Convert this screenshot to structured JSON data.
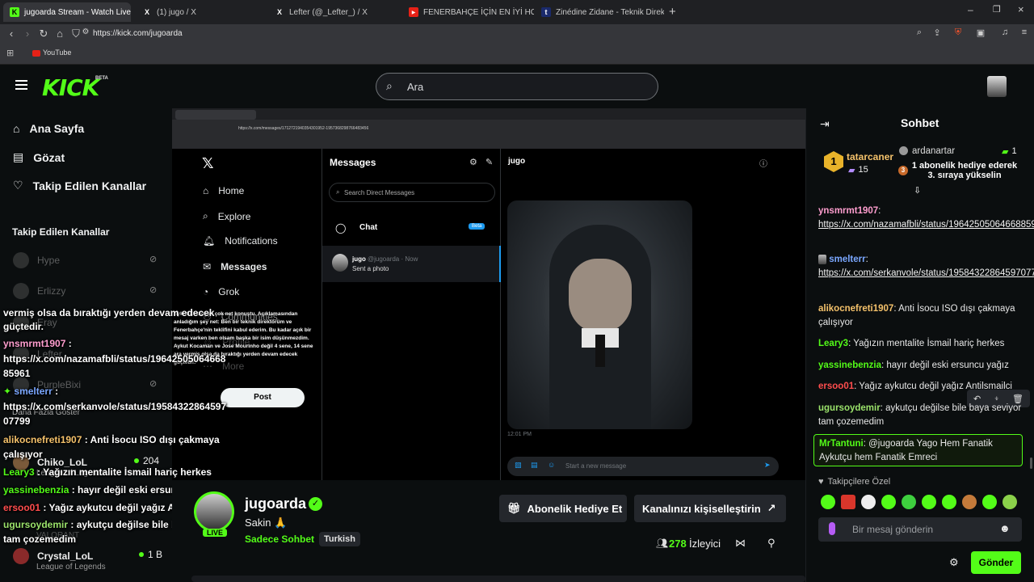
{
  "browser": {
    "tabs": [
      {
        "title": "jugoarda Stream - Watch Live on",
        "favicon": "K",
        "active": true
      },
      {
        "title": "(1) jugo / X",
        "favicon": "X"
      },
      {
        "title": "Lefter (@_Lefter_) / X",
        "favicon": "X"
      },
      {
        "title": "FENERBAHÇE İÇİN EN İYİ HOCA..? | S",
        "favicon": "▶"
      },
      {
        "title": "Zinédine Zidane - Teknik Direktör pro",
        "favicon": "t"
      }
    ],
    "url": "https://kick.com/jugoarda",
    "bookmark": "YouTube"
  },
  "kick": {
    "logo": "KICK",
    "beta": "BETA",
    "search_placeholder": "Ara",
    "nav": [
      {
        "label": "Ana Sayfa",
        "icon": "home-icon"
      },
      {
        "label": "Gözat",
        "icon": "browse-icon"
      },
      {
        "label": "Takip Edilen Kanallar",
        "icon": "heart-icon"
      }
    ],
    "followed_header": "Takip Edilen Kanallar",
    "followed": [
      {
        "name": "Hype"
      },
      {
        "name": "Erlizzy"
      },
      {
        "name": "Eray"
      },
      {
        "name": "Lefter"
      },
      {
        "name": "PurpleBixi"
      }
    ],
    "show_more": "Daha Fazla Göster",
    "recommended": [
      {
        "name": "Chiko_LoL",
        "viewers": "204",
        "game": "League of Legends"
      },
      {
        "name": "Crystal_LoL",
        "viewers": "1 B",
        "game": "League of Legends"
      }
    ],
    "valorant_label": "VALORANT"
  },
  "stream_x": {
    "chrome_url": "https://x.com/messages/1712721940354301952-1957368298766483456",
    "nav": [
      "Home",
      "Explore",
      "Notifications",
      "Messages",
      "Grok",
      "Communities",
      "Profile",
      "More"
    ],
    "post_label": "Post",
    "messages_title": "Messages",
    "search_dm": "Search Direct Messages",
    "chat_label": "Chat",
    "chat_badge": "Beta",
    "convo_name": "jugo",
    "convo_handle": "@jugoarda · Now",
    "convo_preview": "Sent a photo",
    "right_title": "jugo",
    "time": "12:01 PM",
    "composer": "Start a new message",
    "overlay_left_text": "Aykut Kocaman çok net konuştu. Açıklamasından anladığım şey net: Ben bir teknik direktörüm ve Fenerbahçe'nin teklifini kabul ederim. Bu kadar açık bir mesaj varken ben olsam başka bir isim düşünmezdim. Aykut Kocaman ve Jose Mourinho değil 4 sene, 14 sene ara vermiş olsa da bıraktığı yerden devam edecek güçtedir."
  },
  "stream_overlay": [
    {
      "text": "vermiş olsa da bıraktığı yerden devam edecek"
    },
    {
      "text": "güçtedir."
    },
    {
      "user": "ynsmrmt1907",
      "text": ":"
    },
    {
      "text": "https://x.com/nazamafbli/status/19642505064668"
    },
    {
      "text": "85961"
    },
    {
      "user": "smelterr",
      "text": ":"
    },
    {
      "text": "https://x.com/serkanvole/status/19584322864597"
    },
    {
      "text": "07799"
    },
    {
      "user": "alikocnefreti1907",
      "text": ": Anti İsocu ISO dışı çakmaya"
    },
    {
      "text": "çalışıyor"
    },
    {
      "user": "Leary3",
      "text": ": Yağızın mentalite İsmail hariç herkes"
    },
    {
      "user": "yassinebenzia",
      "text": ": hayır değil eski ersuncu yağız"
    },
    {
      "user": "ersoo01",
      "text": ": Yağız aykutcu değil yağız Antilsmailci"
    },
    {
      "user": "ugursoydemir",
      "text": ": aykutçu değilse bile baya seviyor"
    },
    {
      "text": "tam çozemedim"
    }
  ],
  "channel": {
    "name": "jugoarda",
    "title": "Sakin 🙏",
    "category": "Sadece Sohbet",
    "language": "Turkish",
    "live": "LIVE",
    "viewers": "278",
    "viewers_label": "İzleyici",
    "gift_button": "Abonelik Hediye Et",
    "customize_button": "Kanalınızı kişiselleştirin"
  },
  "chat": {
    "title": "Sohbet",
    "pinned": {
      "rank": "1",
      "user1": "tatarcaner",
      "user1_count": "15",
      "user2": "ardanartar",
      "user2_count": "1",
      "rank3": "3",
      "gift_text": "1 abonelik hediye ederek 3. sıraya yükselin"
    },
    "messages": [
      {
        "user": "ynsmrmt1907",
        "color": "#ff9ecf",
        "text": "",
        "link": "https://x.com/nazamafbli/status/1964250506466885961"
      },
      {
        "user": "smelterr",
        "color": "#7aa7ff",
        "text": "",
        "link": "https://x.com/serkanvole/status/1958432286459707799"
      },
      {
        "user": "alikocnefreti1907",
        "color": "#f5c26b",
        "text": "Anti İsocu ISO dışı çakmaya çalışıyor"
      },
      {
        "user": "Leary3",
        "color": "#53fc18",
        "text": "Yağızın mentalite İsmail hariç herkes"
      },
      {
        "user": "yassinebenzia",
        "color": "#53fc18",
        "text": "hayır değil eski ersuncu yağız"
      },
      {
        "user": "ersoo01",
        "color": "#ff4d4d",
        "text": "Yağız aykutcu değil yağız Antilsmailci"
      },
      {
        "user": "ugursoydemir",
        "color": "#9be36b",
        "text": "aykutçu değilse bile baya seviyor tam çozemedim"
      },
      {
        "user": "MrTantuni",
        "color": "#53fc18",
        "text": "@jugoarda Yago Hem Fanatik Aykutçu hem Fanatik Emreci"
      }
    ],
    "followers_only": "Takipçilere Özel",
    "input_placeholder": "Bir mesaj gönderin",
    "send": "Gönder"
  },
  "colors": {
    "accent": "#53fc18",
    "bg": "#0b0e0f",
    "panel": "#24272c"
  }
}
